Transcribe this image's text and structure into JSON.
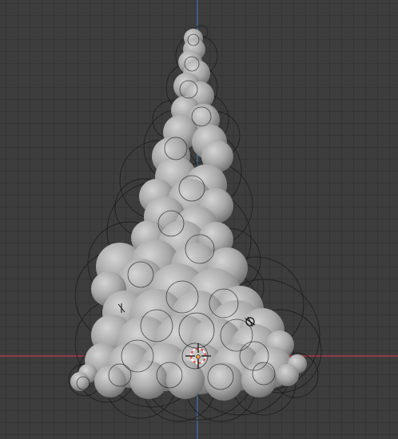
{
  "viewport": {
    "view": "3d-viewport-front-orthographic",
    "colors": {
      "background": "#3d3d3d",
      "grid_line": "#353535",
      "x_axis": "#ad3a44",
      "z_axis": "#3f6ea3",
      "metaball_fill": "#a3a3a3",
      "influence_circle": "#1b1b1b",
      "cursor_red": "#e24a3f",
      "cursor_white": "#ffffff"
    },
    "object": {
      "name_visible": false,
      "icon": "metaball-object-icon",
      "shading": "solid-grey"
    },
    "gizmos": {
      "origin_icon": "object-origin-icon",
      "cursor_icon": "3d-cursor-icon",
      "light_icon": "light-icon"
    }
  }
}
